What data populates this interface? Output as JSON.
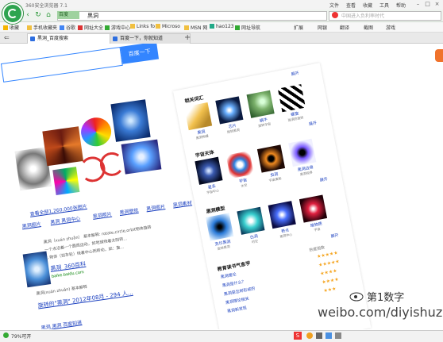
{
  "app_title": "360安全浏览器 7.1",
  "menus": [
    "文件",
    "查看",
    "收藏",
    "工具",
    "帮助"
  ],
  "url": "黑洞",
  "engine": "百度",
  "search_placeholder": "中国进入负利率时代",
  "favorites": [
    "收藏",
    "手机收藏夹",
    "谷歌",
    "网址大全",
    "游戏中心",
    "Links fo",
    "Microso",
    "MSN 网",
    "hao123",
    "网址导航",
    "扩展",
    "网银",
    "翻译",
    "截图",
    "游戏"
  ],
  "tabs": [
    {
      "label": "黑洞_百度搜索"
    },
    {
      "label": "百度一下，你就知道"
    }
  ],
  "left_page": {
    "search_button": "百度一下",
    "more_images": "查看全部1,260,000张图片",
    "links": [
      "黑洞图片",
      "黑洞 黑洞中心",
      "黑洞照片",
      "黑洞壁纸",
      "黑洞图片",
      "黑洞素材"
    ],
    "text_lines": [
      "黑洞（xuán zhuǎn） 基本解释: rotate,circle,orbit物体旋转",
      "一个点沿着一个圆周运动，如地球绕着太阳转...",
      "1.物体（如车轮）绕着中心而转动，如：旋...",
      "黑洞_360百科",
      "baike.baidu.com",
      "黑洞(xuán zhuǎn) 基本解释",
      "旋转的\"黑洞\" 2012年08月 - 294 人...",
      "黑洞 黑洞 百度知道"
    ]
  },
  "right_panel": {
    "more_top": "展开",
    "sections": [
      {
        "title": "相关词汇",
        "items": [
          {
            "cap": "黑洞",
            "sub": "黑洞物理"
          },
          {
            "cap": "芯片",
            "sub": "旋转黑洞"
          },
          {
            "cap": "蜗牛",
            "sub": "旋转宇宙"
          },
          {
            "cap": "螺旋",
            "sub": "漩涡的旋转"
          }
        ]
      },
      {
        "title": "宇宙天体",
        "items": [
          {
            "cap": "星系",
            "sub": "宇宙中心"
          },
          {
            "cap": "宇宙",
            "sub": "太空"
          },
          {
            "cap": "虫洞",
            "sub": "宇宙奥秘"
          },
          {
            "cap": "黑洞边缘",
            "sub": "黑洞视界"
          }
        ]
      },
      {
        "title": "黑洞模型",
        "items": [
          {
            "cap": "克尔黑洞",
            "sub": "旋转黑洞"
          },
          {
            "cap": "白洞",
            "sub": "时空"
          },
          {
            "cap": "奇点",
            "sub": "黑洞中心"
          },
          {
            "cap": "暗物质",
            "sub": "宇宙"
          }
        ]
      }
    ],
    "more_labels": [
      "展开",
      "展开",
      "展开"
    ],
    "list_title": "教育读书气息学",
    "list_header": "热度指数",
    "list_rows": [
      "黑洞理论",
      "黑洞是什么？",
      "黑洞是怎样形成的",
      "黑洞理论相关",
      "黑洞新发现"
    ]
  },
  "status": {
    "zoom": "79%可开"
  },
  "watermark": "weibo.com/diyishuzi",
  "watermark_top": "第1数字"
}
